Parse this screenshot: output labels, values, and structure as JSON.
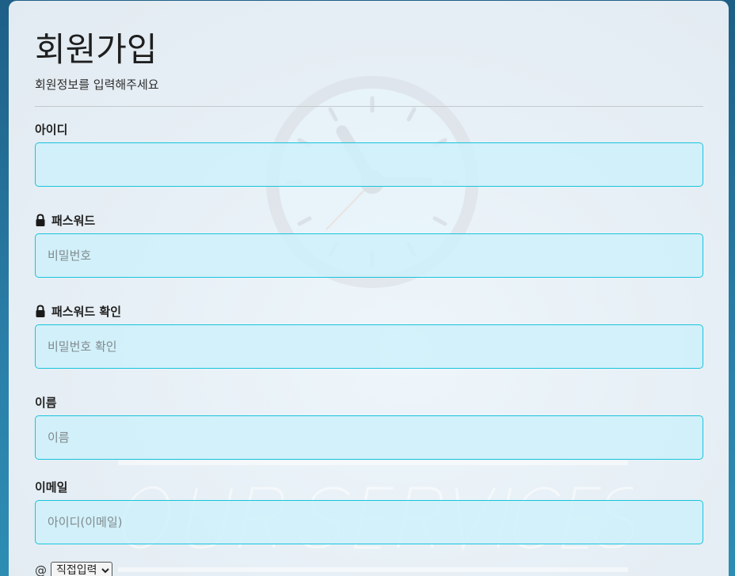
{
  "page": {
    "title": "회원가입",
    "subtitle": "회원정보를 입력해주세요"
  },
  "fields": {
    "id": {
      "label": "아이디",
      "placeholder": "",
      "value": ""
    },
    "password": {
      "label": "패스워드",
      "placeholder": "비밀번호",
      "icon": "lock-icon"
    },
    "password_confirm": {
      "label": "패스워드 확인",
      "placeholder": "비밀번호 확인",
      "icon": "lock-icon"
    },
    "name": {
      "label": "이름",
      "placeholder": "이름"
    },
    "email": {
      "label": "이메일",
      "placeholder": "아이디(이메일)",
      "at_symbol": "@",
      "domain_select": {
        "selected": "직접입력",
        "options": [
          "직접입력"
        ]
      }
    }
  },
  "colors": {
    "input_border": "#18c4dd",
    "input_background": "#cdf0fa",
    "page_background": "#2a7fa8"
  }
}
